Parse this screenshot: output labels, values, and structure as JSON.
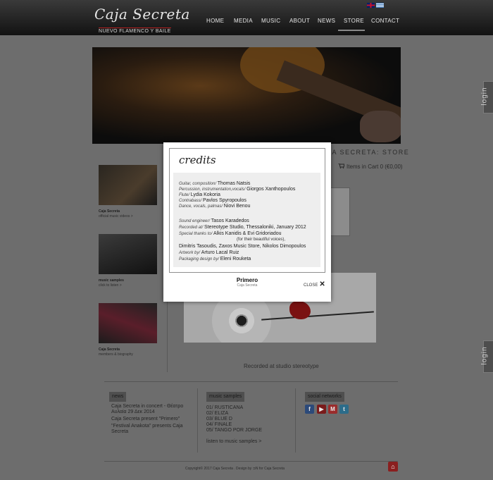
{
  "header": {
    "logo": "Caja Secreta",
    "tagline": "NUEVO FLAMENCO Y BAILE",
    "nav": [
      "HOME",
      "MEDIA",
      "MUSIC",
      "ABOUT",
      "NEWS",
      "STORE",
      "CONTACT"
    ],
    "active_nav": "STORE",
    "languages": [
      "en-flag-icon",
      "gr-flag-icon"
    ]
  },
  "side": {
    "login": "login"
  },
  "store": {
    "title": "AJA SECRETA: STORE",
    "cart_text": "Items in Cart  0 (€0,00)"
  },
  "left_column": [
    {
      "title": "Caja Secreta",
      "subtitle": "official music videos >"
    },
    {
      "title": "music samples",
      "subtitle": "click to listen >"
    },
    {
      "title": "Caja Secreta",
      "subtitle": "members & biography"
    }
  ],
  "album_caption": "Recorded at studio stereotype",
  "footer": {
    "news": {
      "label": "news",
      "items": [
        "Caja Secreta in concert - Θέατρο Αυλαία 29 Δεκ 2014",
        "Caja Secreta present \"Primero\"",
        "\"Festival Anakota\" presents Caja Secreta"
      ]
    },
    "music": {
      "label": "music samples",
      "tracks": [
        "01/ RUSTICANA",
        "02/ ELIZA",
        "03/ BLUE D",
        "04/ FINALE",
        "05/ TANGO POR JORGE"
      ],
      "listen": "listen to music samples >"
    },
    "social": {
      "label": "social networks",
      "icons": [
        "facebook-icon",
        "youtube-icon",
        "gmail-icon",
        "twitter-icon"
      ]
    },
    "copyright": "Copyright© 2017 Caja Secreta . Design by  ⊐N  for Caja Secreta"
  },
  "modal": {
    "heading": "credits",
    "credits": [
      {
        "role": "Guitar, composition/",
        "name": "Thomas Natsis"
      },
      {
        "role": "Percussion, instrumentation,vocals/",
        "name": "Giorgos Xanthopoulos"
      },
      {
        "role": "Flute/",
        "name": "Lydia Kokoria"
      },
      {
        "role": "Contrabass/",
        "name": "Pavlos Spyropoulos"
      },
      {
        "role": "Dance, vocals, palmas/",
        "name": "Niovi Benou"
      },
      {
        "role": "Sound engineer/",
        "name": "Tasos Karadedos"
      },
      {
        "role": "Recorded at/",
        "name": "Stereotype Studio, Thessaloniki, January 2012"
      },
      {
        "role": "Special thanks to/",
        "name": "Alkis Kanidis & Evi Gridoriadou"
      },
      {
        "role": "",
        "name": "(for their beautiful voices),"
      },
      {
        "role": "",
        "name": "Dimitris Tasoudis, Zaxos Music Store, Nikolos Dimopoulos"
      },
      {
        "role": "Artwork by/",
        "name": "Arturo Lacal Ruiz"
      },
      {
        "role": "Packaging design by/",
        "name": "Eleni Rouketa"
      }
    ],
    "album_title": "Primero",
    "album_artist": "Caja Secreta",
    "close_label": "CLOSE"
  }
}
